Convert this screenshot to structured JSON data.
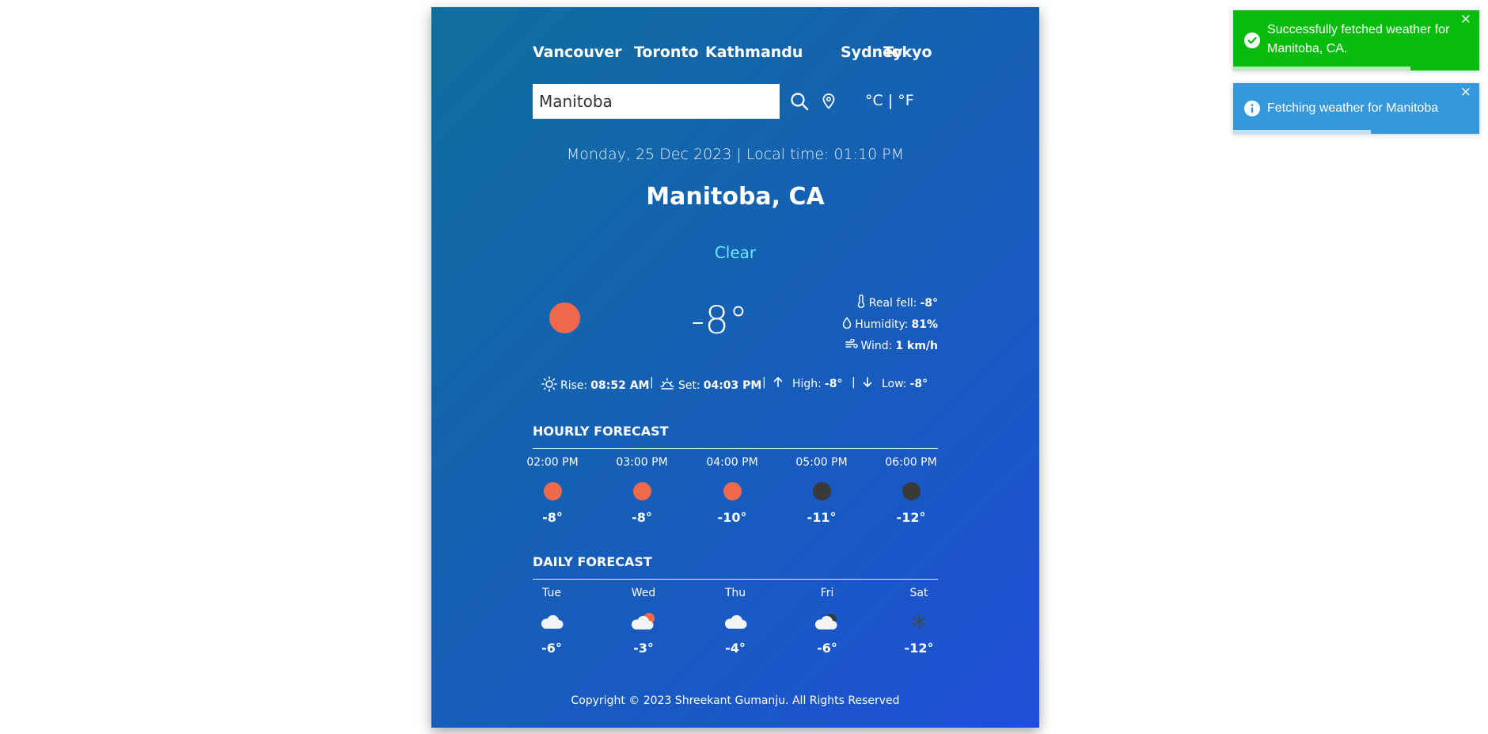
{
  "nav": {
    "cities": [
      "Vancouver",
      "Toronto",
      "Kathmandu",
      "Sydney",
      "Tokyo"
    ]
  },
  "search": {
    "value": "Manitoba",
    "search_icon": "search-icon",
    "location_icon": "location-pin-icon",
    "units": {
      "celsius": "°C",
      "separator": "|",
      "fahrenheit": "°F"
    }
  },
  "current": {
    "datetime": "Monday, 25 Dec 2023 | Local time: 01:10 PM",
    "location": "Manitoba, CA",
    "condition": "Clear",
    "temp": "-8°",
    "real_feel_label": "Real fell:",
    "real_feel": "-8°",
    "humidity_label": "Humidity:",
    "humidity": "81%",
    "wind_label": "Wind:",
    "wind": "1 km/h",
    "rise_label": "Rise:",
    "rise": "08:52 AM",
    "set_label": "Set:",
    "set": "04:03 PM",
    "high_label": "High:",
    "high": "-8°",
    "low_label": "Low:",
    "low": "-8°",
    "separator": "|"
  },
  "hourly": {
    "title": "HOURLY FORECAST",
    "items": [
      {
        "label": "02:00 PM",
        "temp": "-8°",
        "icon": "sun-icon"
      },
      {
        "label": "03:00 PM",
        "temp": "-8°",
        "icon": "sun-icon"
      },
      {
        "label": "04:00 PM",
        "temp": "-10°",
        "icon": "sun-icon"
      },
      {
        "label": "05:00 PM",
        "temp": "-11°",
        "icon": "moon-icon"
      },
      {
        "label": "06:00 PM",
        "temp": "-12°",
        "icon": "moon-icon"
      }
    ]
  },
  "daily": {
    "title": "DAILY FORECAST",
    "items": [
      {
        "label": "Tue",
        "temp": "-6°",
        "icon": "cloud-icon"
      },
      {
        "label": "Wed",
        "temp": "-3°",
        "icon": "cloud-sun-icon"
      },
      {
        "label": "Thu",
        "temp": "-4°",
        "icon": "cloud-icon"
      },
      {
        "label": "Fri",
        "temp": "-6°",
        "icon": "cloud-moon-icon"
      },
      {
        "label": "Sat",
        "temp": "-12°",
        "icon": "snowflake-icon"
      }
    ]
  },
  "footer": {
    "copyright": "Copyright © 2023 Shreekant Gumanju. All Rights Reserved"
  },
  "toasts": [
    {
      "type": "success",
      "message": "Successfully fetched weather for Manitoba, CA.",
      "color": "#07bc0c",
      "progress": 0.72
    },
    {
      "type": "info",
      "message": "Fetching weather for Manitoba",
      "color": "#3498db",
      "progress": 0.56
    }
  ],
  "colors": {
    "card_start": "#0f6f9c",
    "card_end": "#1f4fd8",
    "sun": "#ef6a4c",
    "moon": "#3a3a3a",
    "condition": "#67e8f9"
  }
}
